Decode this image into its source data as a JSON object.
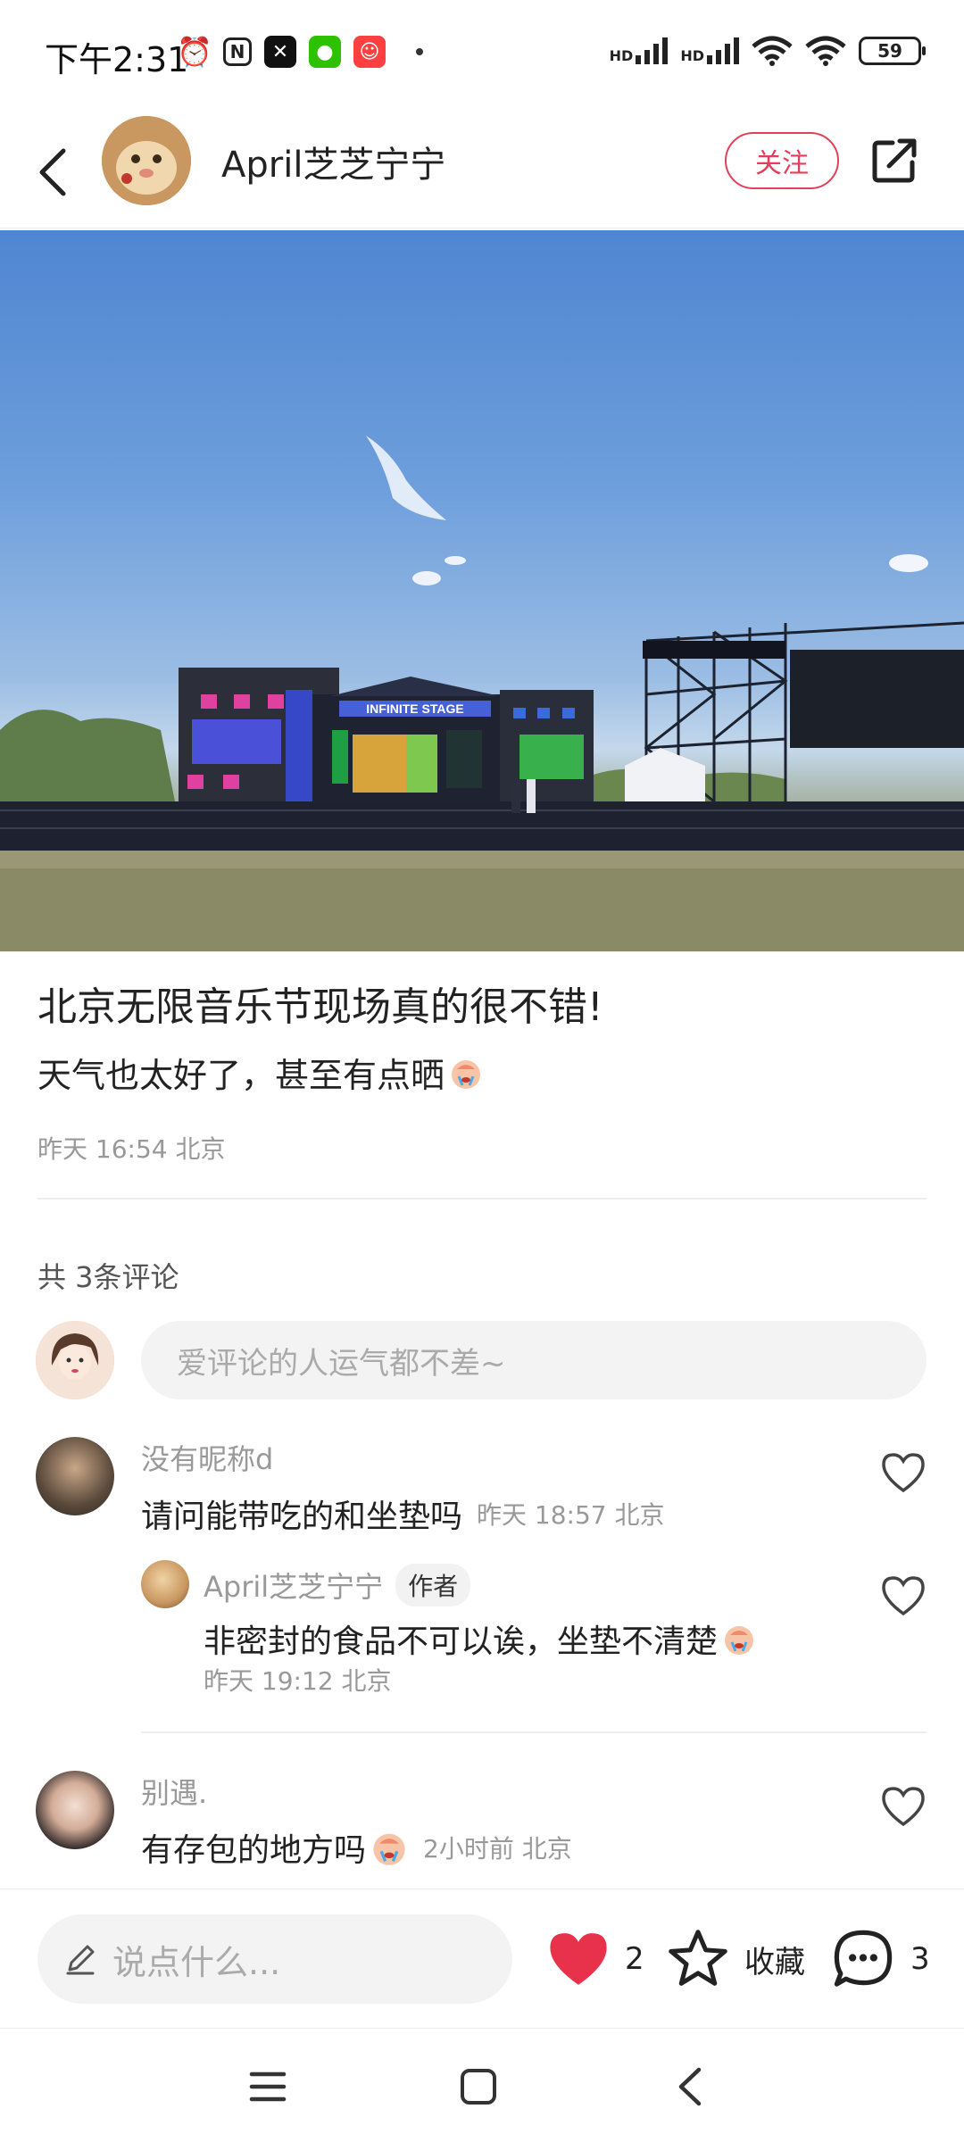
{
  "status_bar": {
    "time": "下午2:31",
    "signal1": "HD",
    "signal2": "HD",
    "battery": "59"
  },
  "header": {
    "author_name": "April芝芝宁宁",
    "follow_label": "关注"
  },
  "post": {
    "title": "北京无限音乐节现场真的很不错!",
    "body": "天气也太好了，甚至有点晒",
    "meta": "昨天 16:54 北京",
    "stage_sign": "INFINITE STAGE"
  },
  "comments_section": {
    "count_label": "共 3条评论",
    "input_placeholder": "爱评论的人运气都不差~"
  },
  "comments": [
    {
      "name": "没有昵称d",
      "text": "请问能带吃的和坐垫吗",
      "meta": "昨天 18:57 北京"
    },
    {
      "name": "April芝芝宁宁",
      "tag": "作者",
      "text": "非密封的食品不可以诶，坐垫不清楚",
      "meta": "昨天 19:12 北京"
    },
    {
      "name": "别遇.",
      "text": "有存包的地方吗",
      "meta": "2小时前  北京"
    }
  ],
  "action_bar": {
    "say_placeholder": "说点什么...",
    "like_count": "2",
    "collect_label": "收藏",
    "comment_count": "3",
    "like_color": "#e8324b"
  }
}
